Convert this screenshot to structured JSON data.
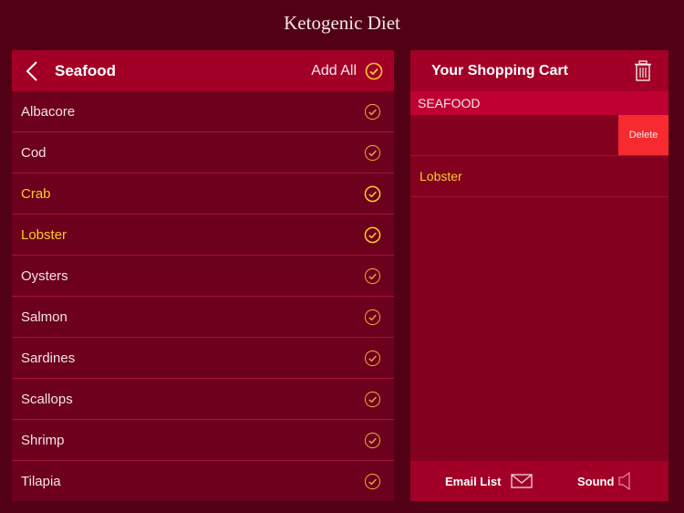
{
  "app": {
    "title": "Ketogenic Diet"
  },
  "colors": {
    "accent_yellow": "#f7cb2e",
    "check_orange": "#e8a13a",
    "delete_red": "#f62a2f",
    "header_red": "#a20026",
    "section_red": "#bf0032"
  },
  "category_panel": {
    "title": "Seafood",
    "back_icon": "chevron-left-icon",
    "add_all_label": "Add All",
    "items": [
      {
        "label": "Albacore",
        "selected": false
      },
      {
        "label": "Cod",
        "selected": false
      },
      {
        "label": "Crab",
        "selected": true
      },
      {
        "label": "Lobster",
        "selected": true
      },
      {
        "label": "Oysters",
        "selected": false
      },
      {
        "label": "Salmon",
        "selected": false
      },
      {
        "label": "Sardines",
        "selected": false
      },
      {
        "label": "Scallops",
        "selected": false
      },
      {
        "label": "Shrimp",
        "selected": false
      },
      {
        "label": "Tilapia",
        "selected": false
      }
    ]
  },
  "cart_panel": {
    "title": "Your Shopping Cart",
    "trash_icon": "trash-icon",
    "section": "SEAFOOD",
    "swiped_row": {
      "label": "",
      "delete_label": "Delete"
    },
    "items": [
      {
        "label": "Lobster"
      }
    ],
    "footer": {
      "email_label": "Email List",
      "sound_label": "Sound"
    }
  }
}
